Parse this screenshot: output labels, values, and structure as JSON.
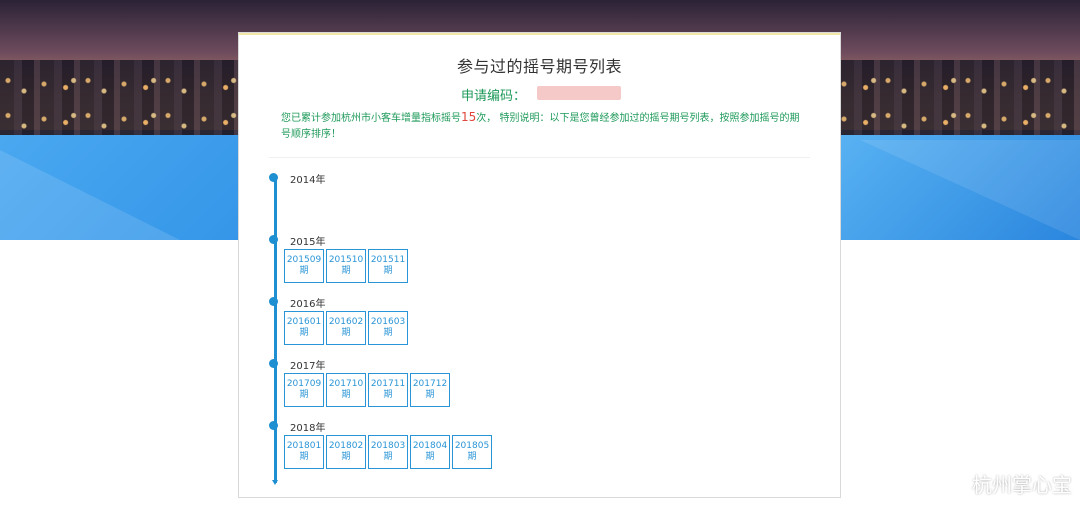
{
  "page": {
    "title": "参与过的摇号期号列表",
    "code_label": "申请编码：",
    "info_prefix": "您已累计参加杭州市小客车增量指标摇号",
    "info_count": "15",
    "info_suffix": "次， 特别说明：以下是您曾经参加过的摇号期号列表，按照参加摇号的期号顺序排序！"
  },
  "timeline": [
    {
      "year": "2014年",
      "periods": []
    },
    {
      "year": "2015年",
      "periods": [
        {
          "code": "201509",
          "unit": "期"
        },
        {
          "code": "201510",
          "unit": "期"
        },
        {
          "code": "201511",
          "unit": "期"
        }
      ]
    },
    {
      "year": "2016年",
      "periods": [
        {
          "code": "201601",
          "unit": "期"
        },
        {
          "code": "201602",
          "unit": "期"
        },
        {
          "code": "201603",
          "unit": "期"
        }
      ]
    },
    {
      "year": "2017年",
      "periods": [
        {
          "code": "201709",
          "unit": "期"
        },
        {
          "code": "201710",
          "unit": "期"
        },
        {
          "code": "201711",
          "unit": "期"
        },
        {
          "code": "201712",
          "unit": "期"
        }
      ]
    },
    {
      "year": "2018年",
      "periods": [
        {
          "code": "201801",
          "unit": "期"
        },
        {
          "code": "201802",
          "unit": "期"
        },
        {
          "code": "201803",
          "unit": "期"
        },
        {
          "code": "201804",
          "unit": "期"
        },
        {
          "code": "201805",
          "unit": "期"
        }
      ]
    }
  ],
  "watermark": {
    "text": "杭州掌心宝",
    "icon": "weibo-icon"
  },
  "colors": {
    "accent": "#1e8fd1",
    "info_text": "#1e9a5a",
    "count": "#e0463c"
  }
}
